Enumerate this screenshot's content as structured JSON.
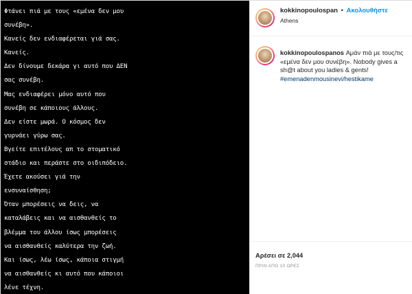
{
  "post": {
    "lines": [
      "Φτάνει πιά με τους «εμένα δεν μου",
      "συνέβη».",
      "Κανείς δεν ενδιαφέρεται γιά σας.",
      "Κανείς.",
      "Δεν δίνουμε δεκάρα γι αυτό που ΔΕΝ",
      "σας συνέβη.",
      "Μας ενδιαφέρει μόνο αυτό που",
      "συνέβη σε κάποιους άλλους.",
      "Δεν είστε μωρά. Ο κόσμος δεν",
      "γυρνάει γύρω σας.",
      "Βγείτε επιτέλους απ το στοματικό",
      "στάδιο και περάστε στο οιδιπόδειο.",
      "Έχετε ακούσει γιά την",
      "ενσυναίσθηση;",
      "Όταν μπορέσεις να δεις, να",
      "καταλάβεις και να αισθανθείς το",
      "βλέμμα του άλλου ίσως μπορέσεις",
      "να αισθανθείς καλύτερα την ζωή.",
      "Και ίσως, λέω ίσως, κάποια στιγμή",
      "να αισθανθείς κι αυτό που κάποιοι",
      "λένε τέχνη."
    ]
  },
  "header": {
    "username": "kokkinopoulospan",
    "separator": "•",
    "follow_label": "Ακολουθήστε",
    "location": "Athens"
  },
  "caption": {
    "username": "kokkinopoulospanos",
    "text": "Αμάν πιά με τους/τις «εμένα δεν μου συνέβη». Nobody gives a sh@t about you ladies & gents!",
    "hashtag": "#emenadenmousinevi/hestikame"
  },
  "footer": {
    "likes": "Αρέσει σε 2,044",
    "timestamp": "ΠΡΙΝ ΑΠΟ 10 ΩΡΕΣ"
  },
  "colors": {
    "follow_blue": "#0095f6",
    "hashtag_blue": "#00376b",
    "image_background": "#000000"
  }
}
